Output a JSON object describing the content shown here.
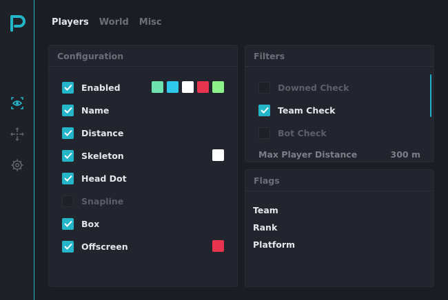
{
  "colors": {
    "accent": "#24b5c8",
    "background": "#1b1d24",
    "panel": "#22252d"
  },
  "sidebar": {
    "logo_icon": "p-logo-icon",
    "items": [
      {
        "icon": "eye-icon",
        "active": true
      },
      {
        "icon": "crosshair-icon",
        "active": false
      },
      {
        "icon": "gear-icon",
        "active": false
      }
    ]
  },
  "tabs": [
    {
      "label": "Players",
      "active": true
    },
    {
      "label": "World",
      "active": false
    },
    {
      "label": "Misc",
      "active": false
    }
  ],
  "configuration": {
    "title": "Configuration",
    "items": [
      {
        "label": "Enabled",
        "checked": true,
        "colors": [
          "#6fe0b0",
          "#2ec9ea",
          "#ffffff",
          "#e8344e",
          "#8ef28a"
        ]
      },
      {
        "label": "Name",
        "checked": true
      },
      {
        "label": "Distance",
        "checked": true
      },
      {
        "label": "Skeleton",
        "checked": true,
        "colors": [
          "#ffffff"
        ]
      },
      {
        "label": "Head Dot",
        "checked": true
      },
      {
        "label": "Snapline",
        "checked": false
      },
      {
        "label": "Box",
        "checked": true
      },
      {
        "label": "Offscreen",
        "checked": true,
        "colors": [
          "#e8344e"
        ]
      }
    ]
  },
  "filters": {
    "title": "Filters",
    "items": [
      {
        "label": "Downed Check",
        "checked": false
      },
      {
        "label": "Team Check",
        "checked": true
      },
      {
        "label": "Bot Check",
        "checked": false
      }
    ],
    "max_distance_label": "Max Player Distance",
    "max_distance_value": "300 m"
  },
  "flags": {
    "title": "Flags",
    "items": [
      "Team",
      "Rank",
      "Platform"
    ]
  }
}
